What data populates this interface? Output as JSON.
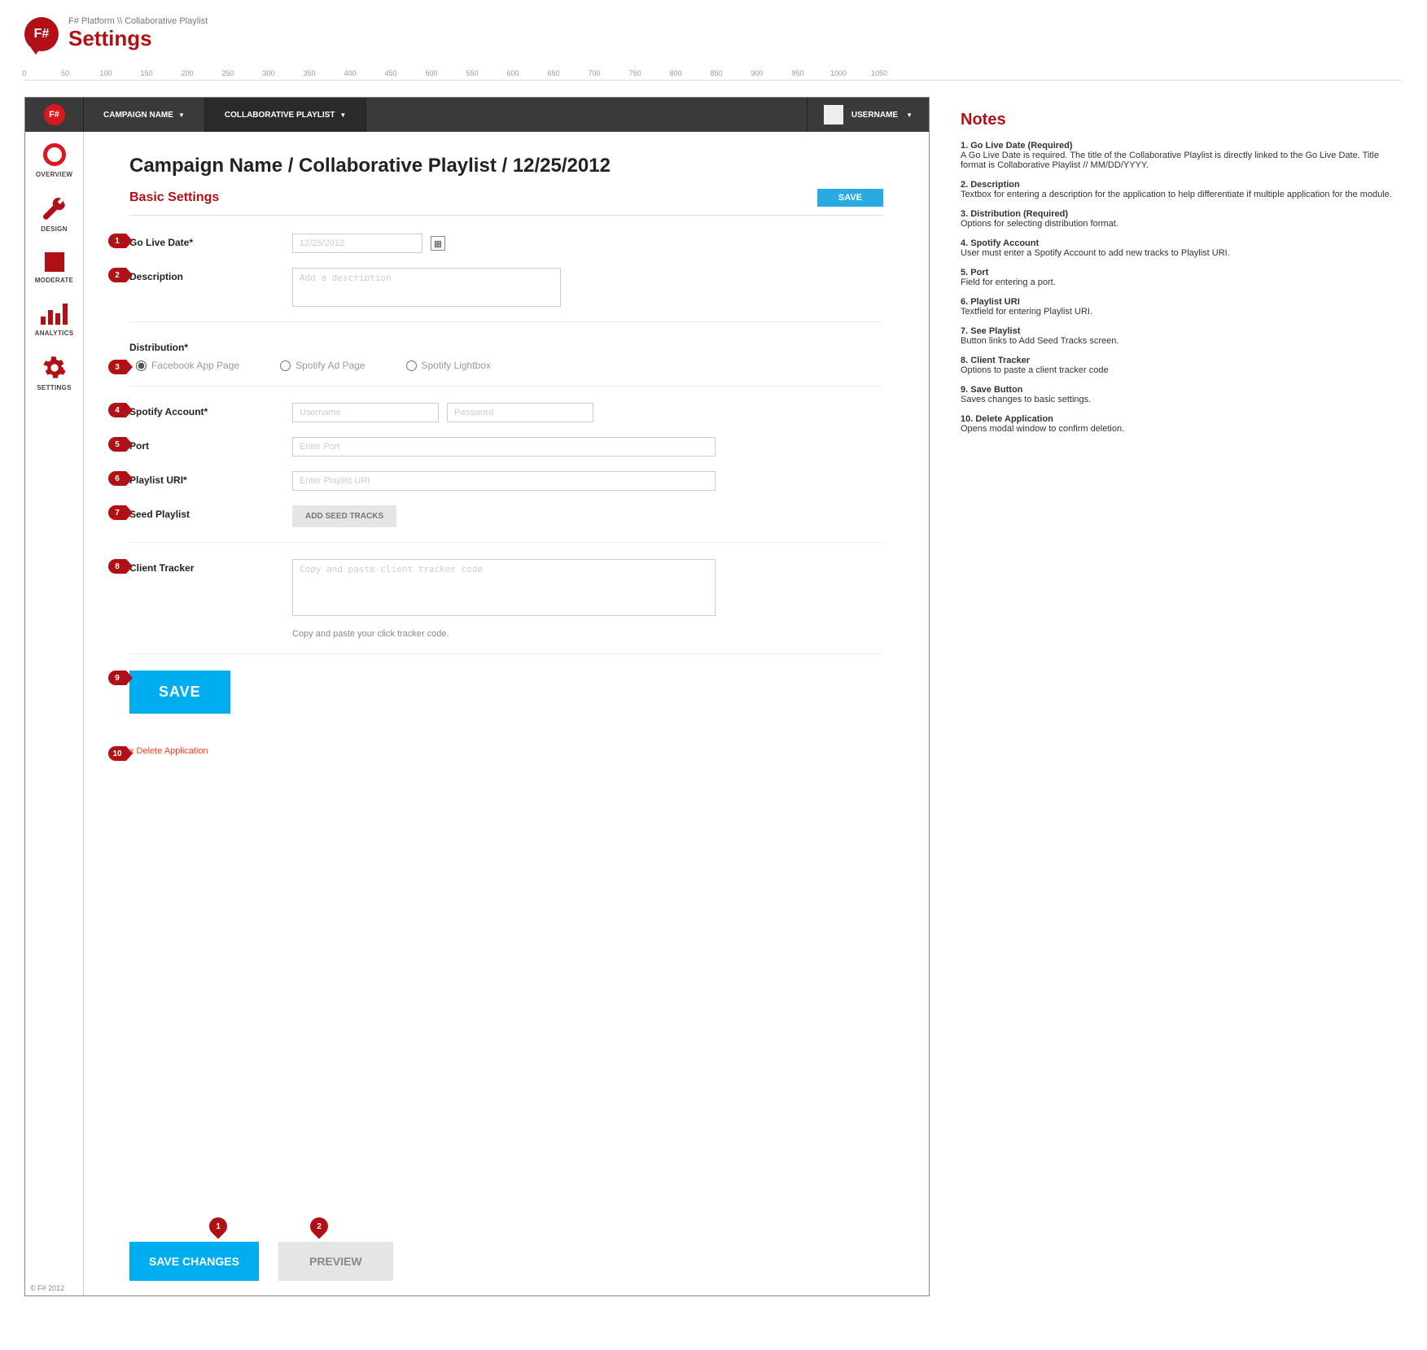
{
  "header": {
    "breadcrumb": "F# Platform \\\\ Collaborative Playlist",
    "title": "Settings",
    "logo_text": "F#"
  },
  "ruler": [
    "0",
    "50",
    "100",
    "150",
    "200",
    "250",
    "300",
    "350",
    "400",
    "450",
    "500",
    "550",
    "600",
    "650",
    "700",
    "750",
    "800",
    "850",
    "900",
    "950",
    "1000",
    "1050"
  ],
  "topnav": {
    "campaign": "CAMPAIGN NAME",
    "playlist": "COLLABORATIVE PLAYLIST",
    "username": "USERNAME"
  },
  "sidebar": {
    "overview": "OVERVIEW",
    "design": "DESIGN",
    "moderate": "MODERATE",
    "analytics": "ANALYTICS",
    "settings": "SETTINGS"
  },
  "main": {
    "page_title": "Campaign Name / Collaborative Playlist / 12/25/2012",
    "section_title": "Basic Settings",
    "save_btn_top": "SAVE",
    "labels": {
      "go_live": "Go Live Date*",
      "description": "Description",
      "distribution": "Distribution*",
      "spotify_account": "Spotify Account*",
      "port": "Port",
      "playlist_uri": "Playlist URI*",
      "seed_playlist": "Seed Playlist",
      "client_tracker": "Client Tracker"
    },
    "placeholders": {
      "go_live": "12/25/2012",
      "description": "Add a description",
      "username": "Username",
      "password": "Password",
      "port": "Enter Port",
      "playlist_uri": "Enter Playlist URI",
      "client_tracker": "Copy and paste client tracker code"
    },
    "distribution": {
      "fb": "Facebook App Page",
      "spotify_ad": "Spotify Ad Page",
      "spotify_lightbox": "Spotify Lightbox"
    },
    "add_seed_tracks": "ADD SEED TRACKS",
    "tracker_helper": "Copy and paste your click tracker code.",
    "save_btn": "SAVE",
    "delete_link": "x Delete Application",
    "save_changes": "SAVE CHANGES",
    "preview": "PREVIEW",
    "copyright": "© F# 2012"
  },
  "callouts": {
    "c1": "1",
    "c2": "2",
    "c3": "3",
    "c4": "4",
    "c5": "5",
    "c6": "6",
    "c7": "7",
    "c8": "8",
    "c9": "9",
    "c10": "10",
    "p1": "1",
    "p2": "2"
  },
  "notes": {
    "title": "Notes",
    "items": [
      {
        "t": "1. Go Live Date (Required)",
        "d": "A Go Live Date is required. The title of the Collaborative Playlist is directly linked to the Go Live Date. Title format is Collaborative Playlist // MM/DD/YYYY."
      },
      {
        "t": "2. Description",
        "d": "Textbox for entering a description for the application to help differentiate if multiple application for the module."
      },
      {
        "t": "3. Distribution (Required)",
        "d": "Options for selecting distribution format."
      },
      {
        "t": "4. Spotify Account",
        "d": "User must enter a Spotify Account to add new tracks to Playlist URI."
      },
      {
        "t": "5. Port",
        "d": "Field for entering a port."
      },
      {
        "t": "6. Playlist URI",
        "d": "Textfield for entering Playlist URI."
      },
      {
        "t": "7. See Playlist",
        "d": "Button links to Add Seed Tracks screen."
      },
      {
        "t": "8. Client Tracker",
        "d": "Options to paste a client tracker code"
      },
      {
        "t": "9. Save Button",
        "d": "Saves changes to basic settings."
      },
      {
        "t": "10. Delete Application",
        "d": "Opens modal window to confirm deletion."
      }
    ]
  }
}
